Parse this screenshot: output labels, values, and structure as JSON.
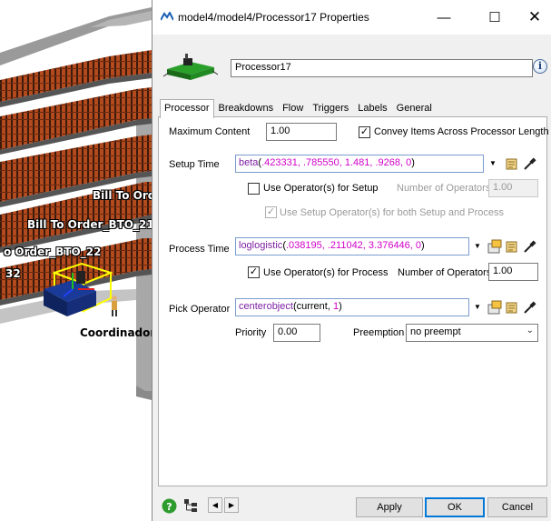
{
  "scene": {
    "labels": [
      "Bill To Orde",
      "Bill To Order_BTO_21",
      "o Order_BTO_22",
      "32",
      "Coordinador"
    ]
  },
  "dialog": {
    "title": "model4/model4/Processor17  Properties",
    "object_name": "Processor17",
    "tabs": [
      "Processor",
      "Breakdowns",
      "Flow",
      "Triggers",
      "Labels",
      "General"
    ],
    "active_tab": "Processor",
    "window_buttons": {
      "minimize": "—",
      "maximize": "☐",
      "close": "✕"
    },
    "processor": {
      "max_content": {
        "label": "Maximum Content",
        "value": "1.00"
      },
      "convey_items": {
        "label": "Convey Items Across Processor Length",
        "checked": true
      },
      "setup_time": {
        "label": "Setup Time",
        "code": {
          "fn": "beta",
          "args": ".423331, .785550, 1.481, .9268, 0"
        }
      },
      "use_operators_setup": {
        "label": "Use Operator(s) for Setup",
        "checked": false
      },
      "setup_num_operators": {
        "label": "Number of Operators",
        "value": "1.00"
      },
      "use_setup_ops_both": {
        "label": "Use Setup Operator(s) for both Setup and Process",
        "checked": true
      },
      "process_time": {
        "label": "Process Time",
        "code": {
          "fn": "loglogistic",
          "args": ".038195, .211042, 3.376446, 0"
        }
      },
      "use_operators_process": {
        "label": "Use Operator(s) for Process",
        "checked": true
      },
      "process_num_operators": {
        "label": "Number of Operators",
        "value": "1.00"
      },
      "pick_operator": {
        "label": "Pick Operator",
        "code": {
          "fn": "centerobject",
          "args_plain": "current, ",
          "args_num": "1"
        }
      },
      "priority": {
        "label": "Priority",
        "value": "0.00"
      },
      "preemption": {
        "label": "Preemption",
        "value": "no preempt"
      }
    },
    "footer": {
      "apply": "Apply",
      "ok": "OK",
      "cancel": "Cancel",
      "help_icon": "?",
      "prev": "◀",
      "next": "▶"
    }
  }
}
